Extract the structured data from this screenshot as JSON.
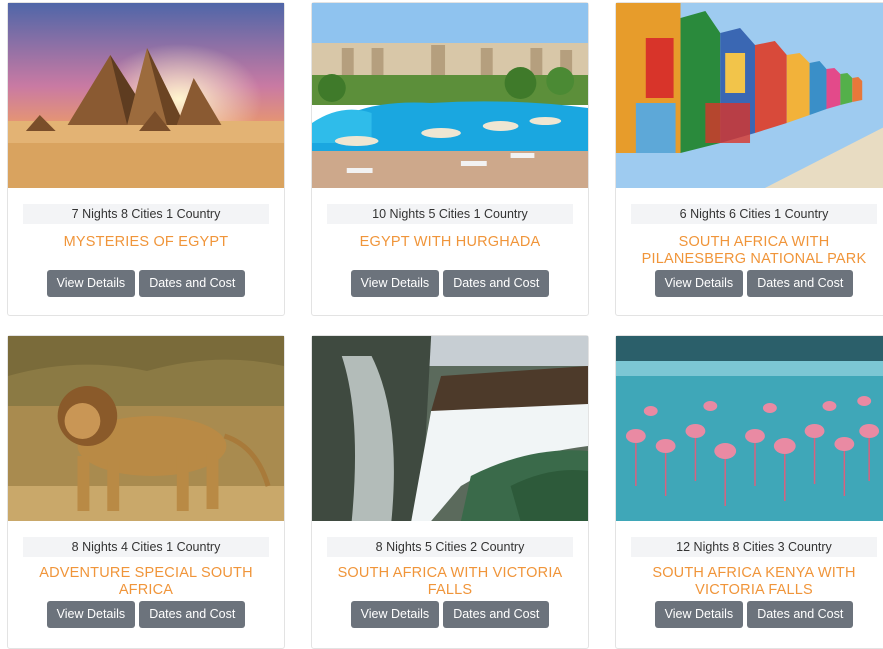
{
  "tours": [
    {
      "meta": "7 Nights 8 Cities 1 Country",
      "title": "MYSTERIES OF EGYPT",
      "image": "pyramids-image",
      "details": "View Details",
      "dates": "Dates and Cost"
    },
    {
      "meta": "10 Nights 5 Cities 1 Country",
      "title": "EGYPT WITH HURGHADA",
      "image": "resort-pool-image",
      "details": "View Details",
      "dates": "Dates and Cost"
    },
    {
      "meta": "6 Nights 6 Cities 1 Country",
      "title": "SOUTH AFRICA WITH PILANESBERG NATIONAL PARK",
      "image": "beach-huts-image",
      "details": "View Details",
      "dates": "Dates and Cost"
    },
    {
      "meta": "8 Nights 4 Cities 1 Country",
      "title": "ADVENTURE SPECIAL SOUTH AFRICA",
      "image": "lion-image",
      "details": "View Details",
      "dates": "Dates and Cost"
    },
    {
      "meta": "8 Nights 5 Cities 2 Country",
      "title": "SOUTH AFRICA WITH VICTORIA FALLS",
      "image": "waterfall-image",
      "details": "View Details",
      "dates": "Dates and Cost"
    },
    {
      "meta": "12 Nights 8 Cities 3 Country",
      "title": "SOUTH AFRICA KENYA WITH VICTORIA FALLS",
      "image": "flamingos-image",
      "details": "View Details",
      "dates": "Dates and Cost"
    }
  ],
  "colors": {
    "title": "#f0953a",
    "button": "#6c737c",
    "meta_bg": "#f3f4f6"
  }
}
